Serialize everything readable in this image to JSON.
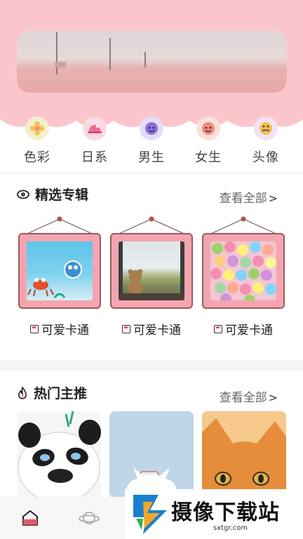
{
  "categories": [
    {
      "label": "色彩",
      "icon": "flower-icon",
      "bg": "#f6eecf"
    },
    {
      "label": "日系",
      "icon": "hat-icon",
      "bg": "#fbd9e2"
    },
    {
      "label": "男生",
      "icon": "boy-face-icon",
      "bg": "#e6ddf5"
    },
    {
      "label": "女生",
      "icon": "girl-face-icon",
      "bg": "#fbe0dc"
    },
    {
      "label": "头像",
      "icon": "mustache-face-icon",
      "bg": "#efe3f6"
    }
  ],
  "featured": {
    "title": "精选专辑",
    "more_label": "查看全部",
    "more_arrow": ">",
    "items": [
      {
        "caption": "可爱卡通",
        "image": "underwater-cartoon"
      },
      {
        "caption": "可爱卡通",
        "image": "teddy-bear-window"
      },
      {
        "caption": "可爱卡通",
        "image": "candy-pile"
      }
    ]
  },
  "hot": {
    "title": "热门主推",
    "more_label": "查看全部",
    "more_arrow": ">",
    "items": [
      {
        "image": "panda-cartoon"
      },
      {
        "image": "white-cat-bottle"
      },
      {
        "image": "orange-kitten"
      }
    ]
  },
  "bottom_nav": [
    {
      "icon": "home-icon",
      "active": true
    },
    {
      "icon": "planet-icon",
      "active": false
    }
  ],
  "watermark": {
    "text": "摄像下载站",
    "url": "sxtgr.com"
  },
  "colors": {
    "header_pink": "#fbc6cb",
    "frame_pink": "#f3a5b0",
    "accent_red": "#e05a6a"
  }
}
